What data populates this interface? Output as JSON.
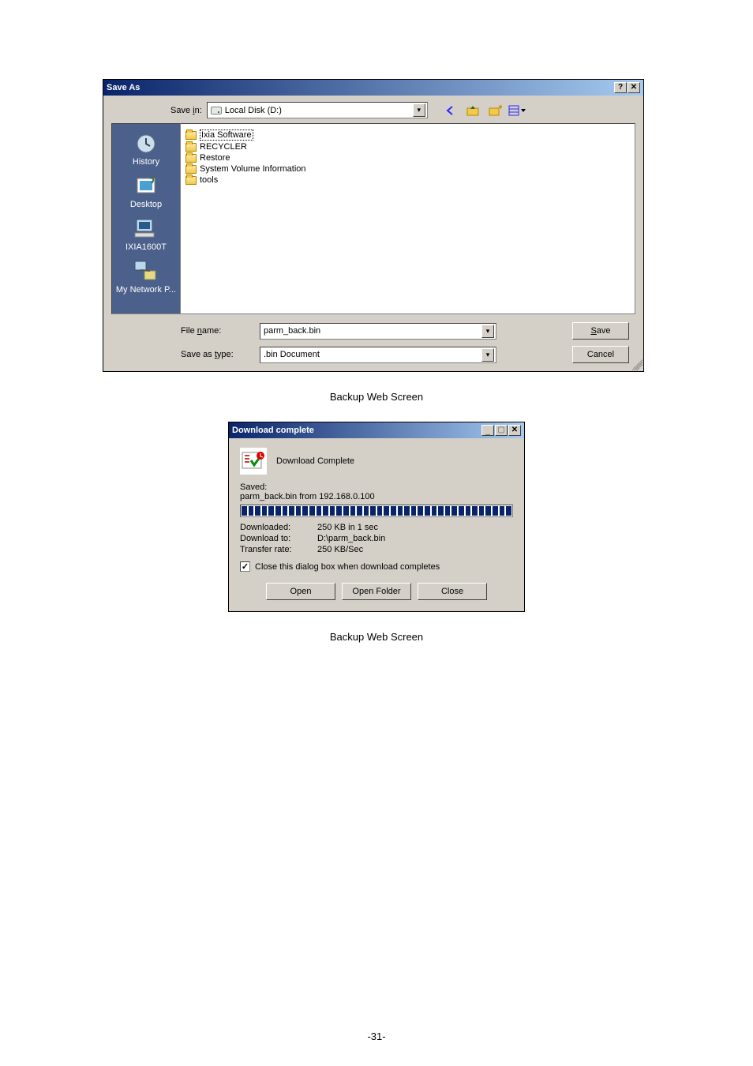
{
  "save_as": {
    "title": "Save As",
    "save_in_label": "Save in:",
    "save_in_value": "Local Disk (D:)",
    "places": [
      "History",
      "Desktop",
      "IXIA1600T",
      "My Network P..."
    ],
    "folders": [
      "Ixia Software",
      "RECYCLER",
      "Restore",
      "System Volume Information",
      "tools"
    ],
    "file_name_label": "File name:",
    "file_name_value": "parm_back.bin",
    "save_as_type_label": "Save as type:",
    "save_as_type_value": ".bin Document",
    "save_btn": "Save",
    "cancel_btn": "Cancel"
  },
  "captions": {
    "c1": "Backup Web Screen",
    "c2": "Backup Web Screen"
  },
  "download": {
    "title": "Download complete",
    "heading": "Download Complete",
    "saved_label": "Saved:",
    "saved_value": "parm_back.bin from 192.168.0.100",
    "rows": {
      "downloaded_k": "Downloaded:",
      "downloaded_v": "250 KB in 1 sec",
      "download_to_k": "Download to:",
      "download_to_v": "D:\\parm_back.bin",
      "transfer_k": "Transfer rate:",
      "transfer_v": "250 KB/Sec"
    },
    "close_checkbox": "Close this dialog box when download completes",
    "open_btn": "Open",
    "open_folder_btn": "Open Folder",
    "close_btn": "Close"
  },
  "page_number": "-31-"
}
